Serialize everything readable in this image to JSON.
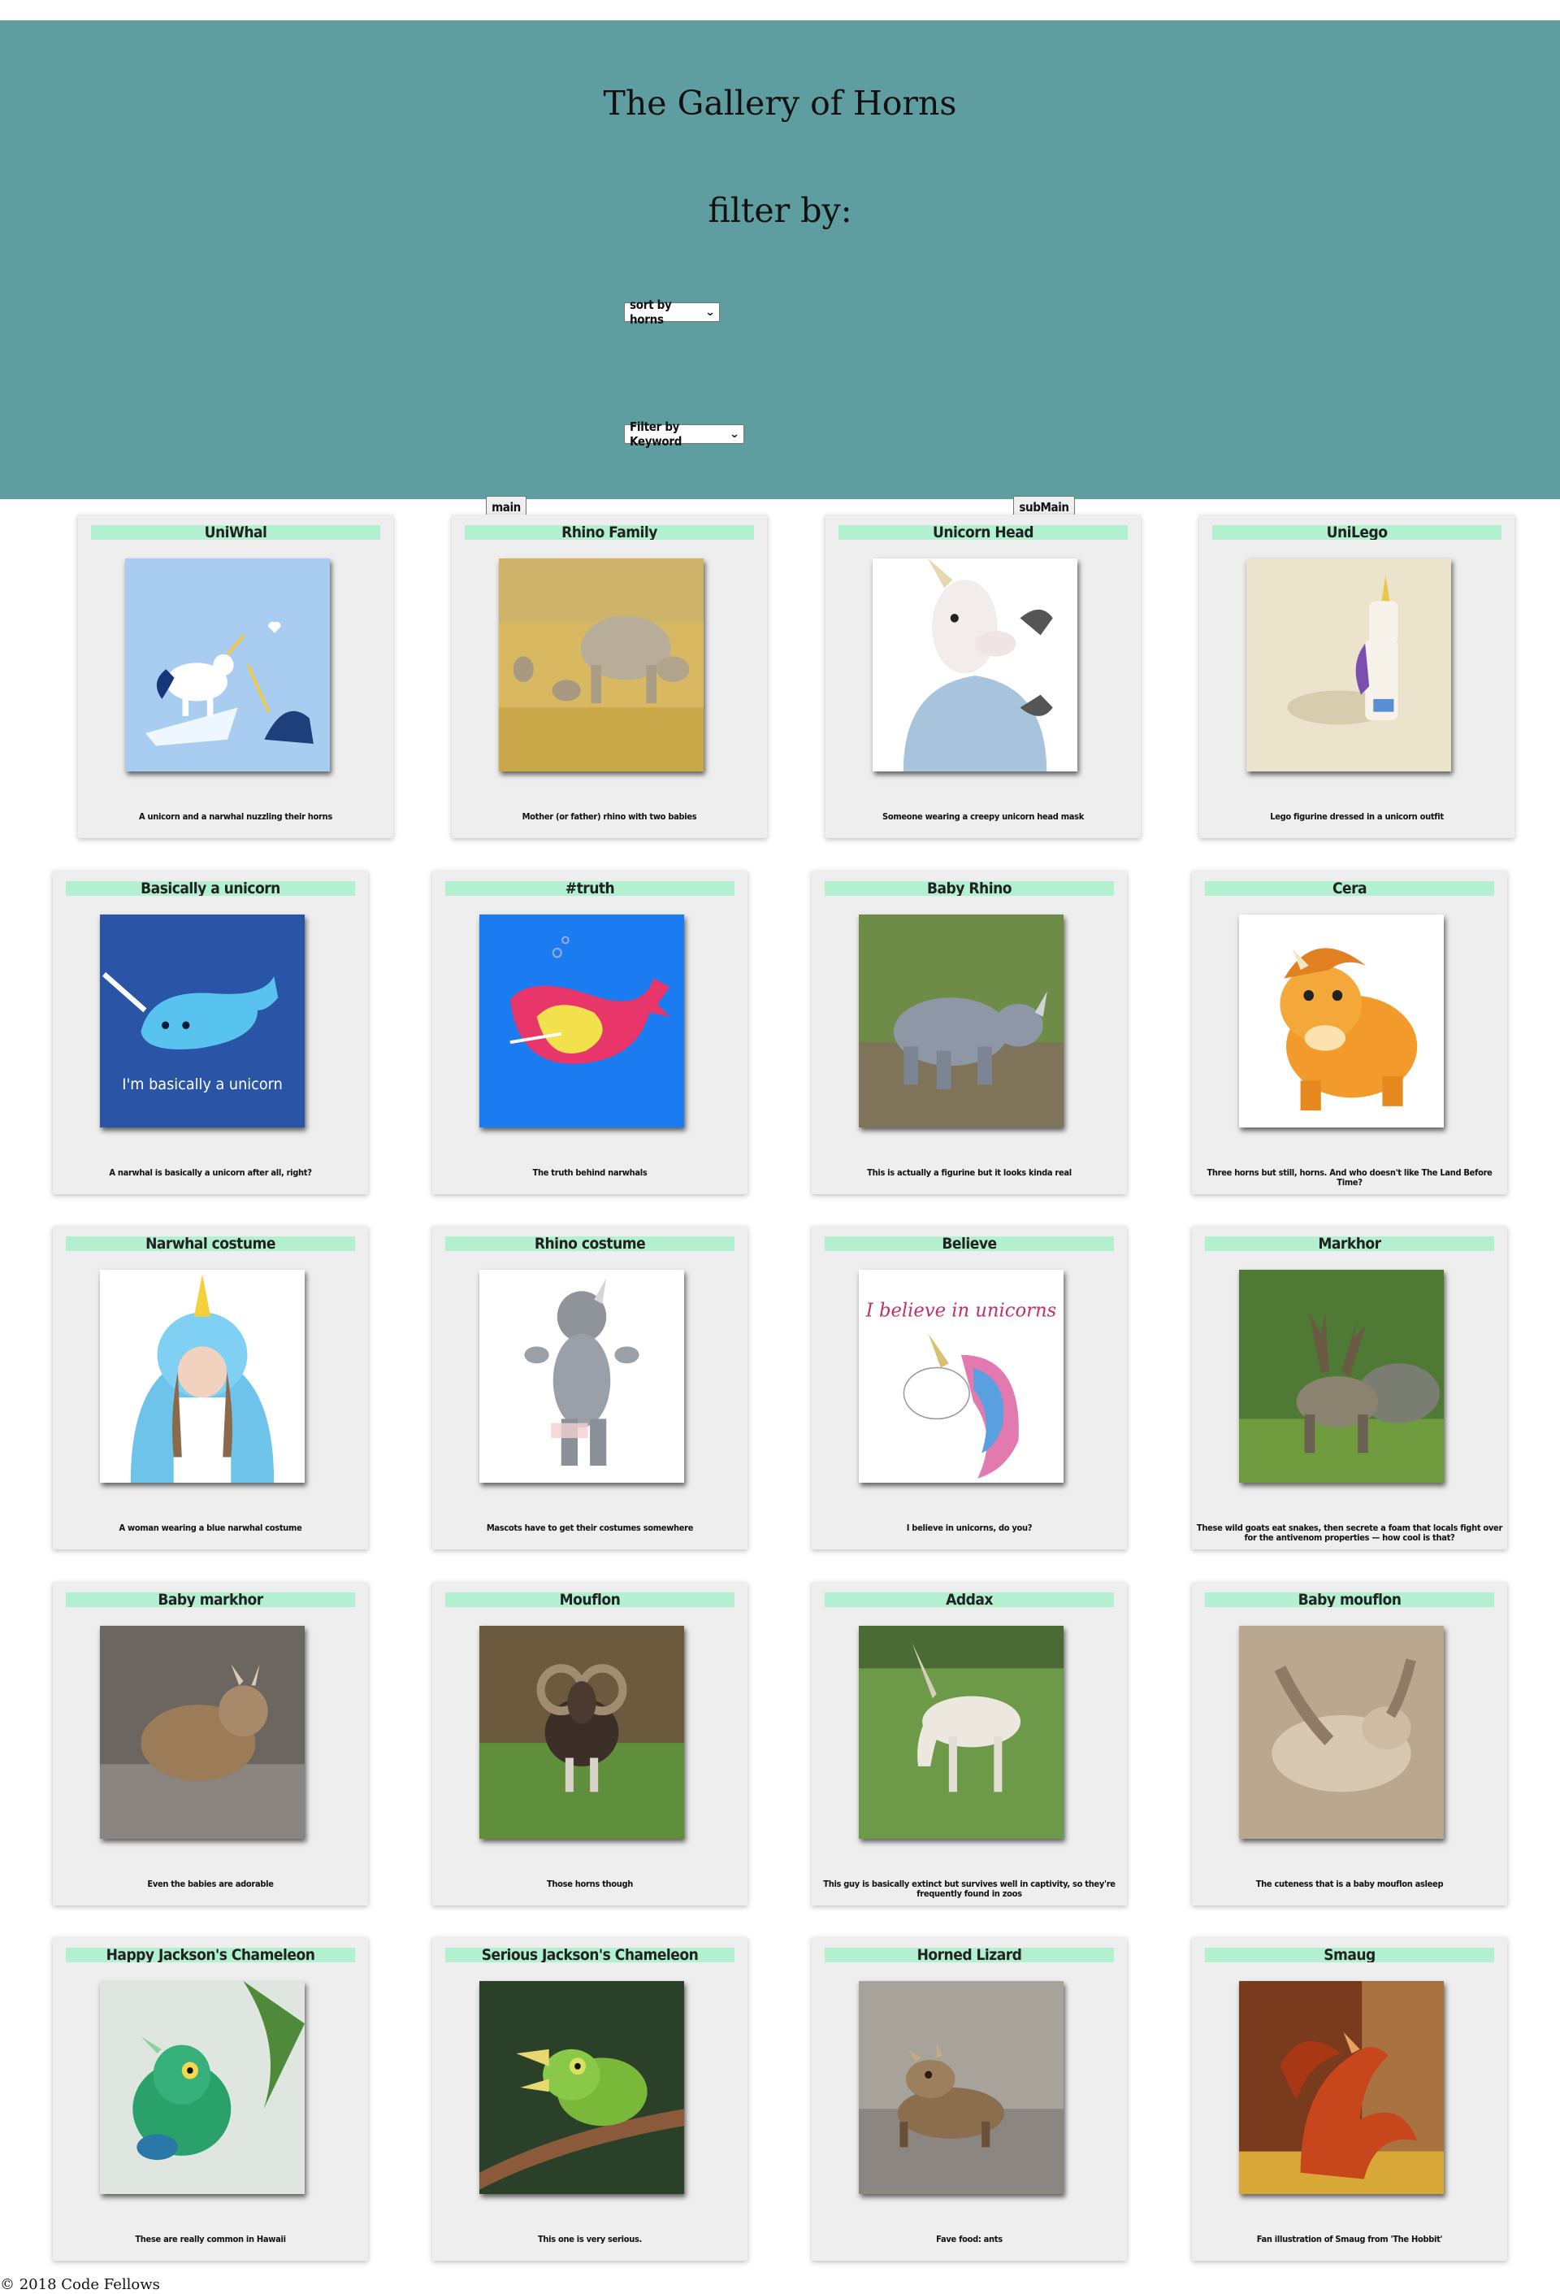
{
  "header": {
    "title": "The Gallery of Horns",
    "filter_heading": "filter by:",
    "sort_select": {
      "selected": "sort by horns"
    },
    "keyword_select": {
      "selected": "Filter by Keyword"
    },
    "main_button": "main",
    "submain_button": "subMain"
  },
  "cards": [
    {
      "title": "UniWhal",
      "description": "A unicorn and a narwhal nuzzling their horns"
    },
    {
      "title": "Rhino Family",
      "description": "Mother (or father) rhino with two babies"
    },
    {
      "title": "Unicorn Head",
      "description": "Someone wearing a creepy unicorn head mask"
    },
    {
      "title": "UniLego",
      "description": "Lego figurine dressed in a unicorn outfit"
    },
    {
      "title": "Basically a unicorn",
      "description": "A narwhal is basically a unicorn after all, right?"
    },
    {
      "title": "#truth",
      "description": "The truth behind narwhals"
    },
    {
      "title": "Baby Rhino",
      "description": "This is actually a figurine but it looks kinda real"
    },
    {
      "title": "Cera",
      "description": "Three horns but still, horns. And who doesn't like The Land Before Time?"
    },
    {
      "title": "Narwhal costume",
      "description": "A woman wearing a blue narwhal costume"
    },
    {
      "title": "Rhino costume",
      "description": "Mascots have to get their costumes somewhere"
    },
    {
      "title": "Believe",
      "description": "I believe in unicorns, do you?"
    },
    {
      "title": "Markhor",
      "description": "These wild goats eat snakes, then secrete a foam that locals fight over for the antivenom properties — how cool is that?"
    },
    {
      "title": "Baby markhor",
      "description": "Even the babies are adorable"
    },
    {
      "title": "Mouflon",
      "description": "Those horns though"
    },
    {
      "title": "Addax",
      "description": "This guy is basically extinct but survives well in captivity, so they're frequently found in zoos"
    },
    {
      "title": "Baby mouflon",
      "description": "The cuteness that is a baby mouflon asleep"
    },
    {
      "title": "Happy Jackson's Chameleon",
      "description": "These are really common in Hawaii"
    },
    {
      "title": "Serious Jackson's Chameleon",
      "description": "This one is very serious."
    },
    {
      "title": "Horned Lizard",
      "description": "Fave food: ants"
    },
    {
      "title": "Smaug",
      "description": "Fan illustration of Smaug from 'The Hobbit'"
    }
  ],
  "unicorn_poster_text": "I'm basically a unicorn",
  "believe_poster_text": "I believe in unicorns",
  "footer": {
    "copyright": "© 2018 Code Fellows"
  },
  "colors": {
    "header_bg": "#5f9ea0",
    "card_bg": "#eeeeee",
    "card_title_bg": "#b2f0d0"
  }
}
